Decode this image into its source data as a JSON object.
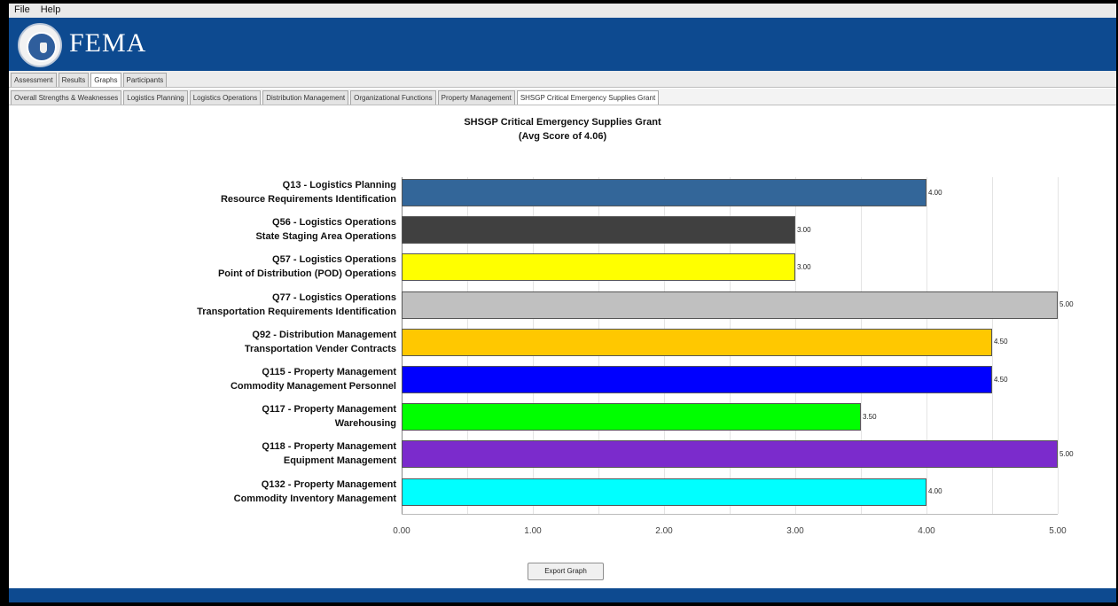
{
  "menu": {
    "file": "File",
    "help": "Help"
  },
  "brand": "FEMA",
  "main_tabs": [
    "Assessment",
    "Results",
    "Graphs",
    "Participants"
  ],
  "main_tab_active": 2,
  "sub_tabs": [
    "Overall Strengths & Weaknesses",
    "Logistics Planning",
    "Logistics Operations",
    "Distribution Management",
    "Organizational Functions",
    "Property Management",
    "SHSGP Critical Emergency Supplies Grant"
  ],
  "sub_tab_active": 6,
  "export_label": "Export Graph",
  "chart_data": {
    "type": "bar",
    "orientation": "horizontal",
    "title": "SHSGP Critical Emergency Supplies Grant",
    "subtitle": "(Avg Score of 4.06)",
    "xlim": [
      0,
      5
    ],
    "ticks": [
      "0.00",
      "1.00",
      "2.00",
      "3.00",
      "4.00",
      "5.00"
    ],
    "grid": true,
    "categories": [
      [
        "Q13 - Logistics Planning",
        "Resource Requirements Identification"
      ],
      [
        "Q56 - Logistics Operations",
        "State Staging Area Operations"
      ],
      [
        "Q57 - Logistics Operations",
        "Point of Distribution (POD) Operations"
      ],
      [
        "Q77 - Logistics Operations",
        "Transportation Requirements Identification"
      ],
      [
        "Q92 - Distribution Management",
        "Transportation Vender Contracts"
      ],
      [
        "Q115 - Property Management",
        "Commodity Management Personnel"
      ],
      [
        "Q117 - Property Management",
        "Warehousing"
      ],
      [
        "Q118 - Property Management",
        "Equipment Management"
      ],
      [
        "Q132 - Property Management",
        "Commodity Inventory Management"
      ]
    ],
    "values": [
      4.0,
      3.0,
      3.0,
      5.0,
      4.5,
      4.5,
      3.5,
      5.0,
      4.0
    ],
    "value_labels": [
      "4.00",
      "3.00",
      "3.00",
      "5.00",
      "4.50",
      "4.50",
      "3.50",
      "5.00",
      "4.00"
    ],
    "colors": [
      "#336699",
      "#404040",
      "#ffff00",
      "#c0c0c0",
      "#ffc800",
      "#0000ff",
      "#00ff00",
      "#7b2bcc",
      "#00ffff"
    ]
  }
}
